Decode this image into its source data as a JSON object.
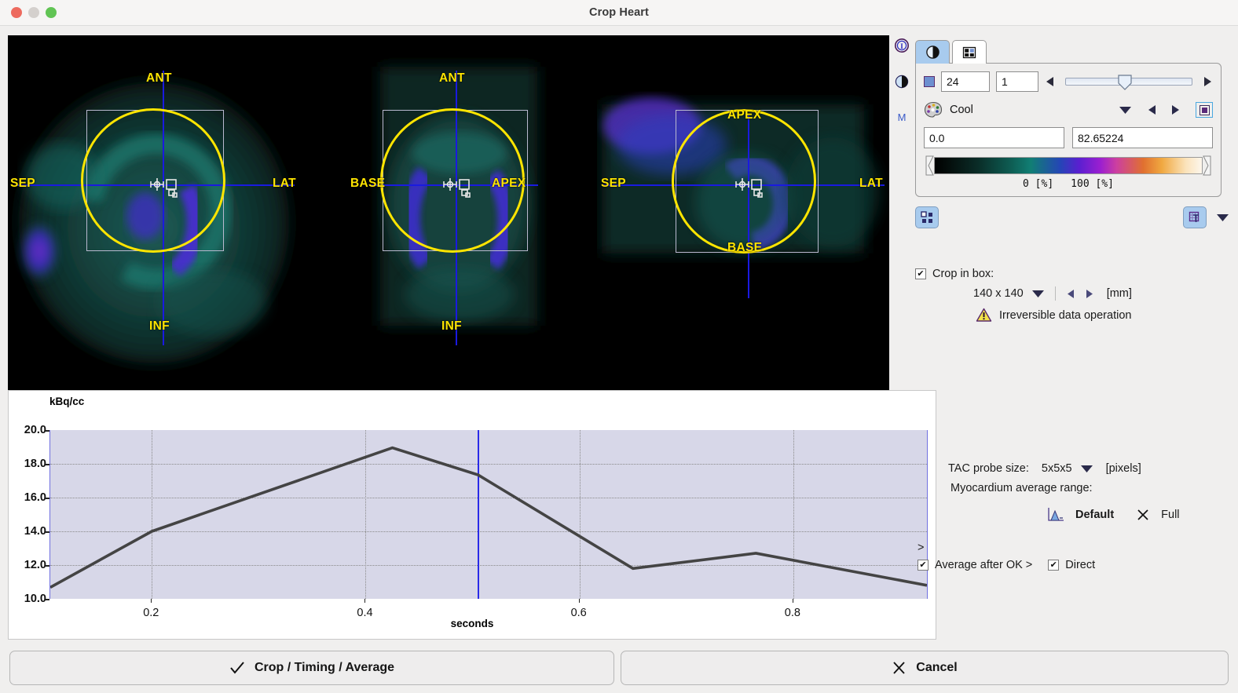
{
  "window": {
    "title": "Crop Heart",
    "controls": [
      "close",
      "minimize",
      "maximize"
    ]
  },
  "viewport": {
    "panes": [
      {
        "name": "short-axis-view",
        "labels": {
          "top": "ANT",
          "bottom": "INF",
          "left": "SEP",
          "right": "LAT"
        }
      },
      {
        "name": "horizontal-long-axis-view",
        "labels": {
          "top": "ANT",
          "bottom": "INF",
          "left": "BASE",
          "right": "APEX"
        }
      },
      {
        "name": "vertical-long-axis-view",
        "labels": {
          "top": "APEX",
          "bottom": "BASE",
          "left": "SEP",
          "right": "LAT"
        }
      }
    ]
  },
  "chart_data": {
    "type": "line",
    "title": "",
    "xlabel": "seconds",
    "ylabel": "kBq/cc",
    "unit_label": "kBq/cc",
    "xlim": [
      0.105,
      0.925
    ],
    "ylim": [
      10.0,
      20.0
    ],
    "grid": true,
    "legend": "none",
    "yticks": [
      "20.0",
      "18.0",
      "16.0",
      "14.0",
      "12.0",
      "10.0"
    ],
    "ytick_values": [
      20.0,
      18.0,
      16.0,
      14.0,
      12.0,
      10.0
    ],
    "xticks": [
      "0.2",
      "0.4",
      "0.6",
      "0.8"
    ],
    "xtick_values": [
      0.2,
      0.4,
      0.6,
      0.8
    ],
    "cursor_x": 0.505,
    "series": [
      {
        "name": "TAC",
        "color": "#444444",
        "x": [
          0.105,
          0.2,
          0.425,
          0.505,
          0.65,
          0.765,
          0.925
        ],
        "values": [
          10.68,
          14.0,
          18.95,
          17.35,
          11.8,
          12.7,
          10.8
        ]
      }
    ]
  },
  "sidebar_icons": [
    {
      "name": "info-icon",
      "glyph": "I"
    },
    {
      "name": "contrast-icon",
      "glyph": "◐"
    },
    {
      "name": "movie-icon",
      "glyph": "M"
    }
  ],
  "right_panel": {
    "tabs": [
      {
        "name": "display-tab",
        "icon": "contrast-icon",
        "active": true
      },
      {
        "name": "layout-tab",
        "icon": "grid-icon",
        "active": false
      }
    ],
    "slice": {
      "slice_value": "24",
      "frame_value": "1",
      "slider_position_pct": 47
    },
    "colormap": {
      "name": "Cool",
      "min_value": "0.0",
      "max_value": "82.65224",
      "legend_min": "0   [%]",
      "legend_max": "100  [%]"
    },
    "crop": {
      "checkbox_label": "Crop in box:",
      "checked": true,
      "size_value": "140 x 140",
      "units": "[mm]",
      "warning": "Irreversible data operation"
    },
    "tac": {
      "probe_label": "TAC probe size:",
      "probe_value": "5x5x5",
      "probe_units": "[pixels]",
      "range_label": "Myocardium average range:",
      "default_button": "Default",
      "full_button": "Full"
    },
    "footer": {
      "chevron": ">",
      "average_after_ok_label": "Average after OK >",
      "average_after_ok_checked": true,
      "direct_label": "Direct",
      "direct_checked": true
    }
  },
  "buttons": {
    "confirm": "Crop / Timing / Average",
    "cancel": "Cancel"
  },
  "colors": {
    "accent": "#a8cbee",
    "roi_circle": "#ffe500",
    "crosshair": "#1a1ae0",
    "plot_bg": "#d7d7e8",
    "trace": "#444444"
  }
}
